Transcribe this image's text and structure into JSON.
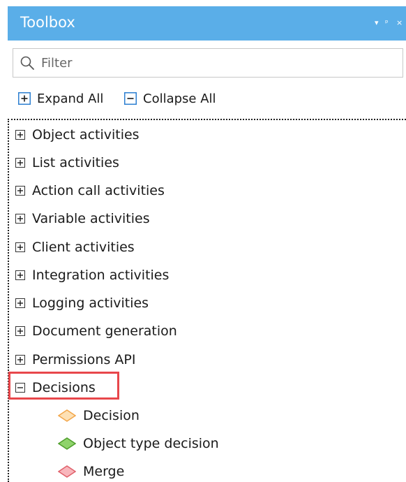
{
  "header": {
    "title": "Toolbox",
    "buttons": [
      "▾",
      "ᵖ",
      "×"
    ]
  },
  "filter": {
    "placeholder": "Filter",
    "value": ""
  },
  "toolbar": {
    "expand_all": "Expand All",
    "collapse_all": "Collapse All"
  },
  "tree": {
    "categories": [
      {
        "label": "Object activities",
        "expanded": false
      },
      {
        "label": "List activities",
        "expanded": false
      },
      {
        "label": "Action call activities",
        "expanded": false
      },
      {
        "label": "Variable activities",
        "expanded": false
      },
      {
        "label": "Client activities",
        "expanded": false
      },
      {
        "label": "Integration activities",
        "expanded": false
      },
      {
        "label": "Logging activities",
        "expanded": false
      },
      {
        "label": "Document generation",
        "expanded": false
      },
      {
        "label": "Permissions API",
        "expanded": false
      },
      {
        "label": "Decisions",
        "expanded": true
      }
    ],
    "decision_children": [
      {
        "label": "Decision",
        "icon": "orange-diamond-icon",
        "fill": "#fde0b4",
        "stroke": "#f2a64a"
      },
      {
        "label": "Object type decision",
        "icon": "green-diamond-icon",
        "fill": "#8fd36b",
        "stroke": "#4f9e2c"
      },
      {
        "label": "Merge",
        "icon": "pink-diamond-icon",
        "fill": "#f8b6bc",
        "stroke": "#e0606a"
      }
    ]
  },
  "colors": {
    "header_bg": "#5aaee8",
    "highlight_border": "#e8474b",
    "expander_border": "#333333"
  }
}
